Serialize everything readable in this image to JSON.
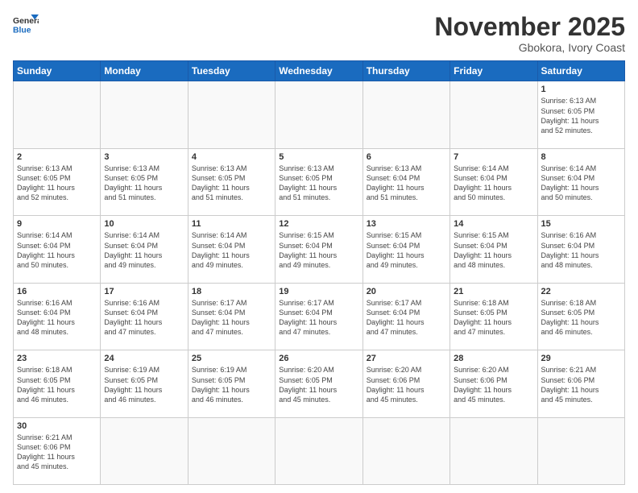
{
  "logo": {
    "text_general": "General",
    "text_blue": "Blue"
  },
  "title": "November 2025",
  "location": "Gbokora, Ivory Coast",
  "days": [
    "Sunday",
    "Monday",
    "Tuesday",
    "Wednesday",
    "Thursday",
    "Friday",
    "Saturday"
  ],
  "weeks": [
    [
      {
        "date": "",
        "text": ""
      },
      {
        "date": "",
        "text": ""
      },
      {
        "date": "",
        "text": ""
      },
      {
        "date": "",
        "text": ""
      },
      {
        "date": "",
        "text": ""
      },
      {
        "date": "",
        "text": ""
      },
      {
        "date": "1",
        "text": "Sunrise: 6:13 AM\nSunset: 6:05 PM\nDaylight: 11 hours\nand 52 minutes."
      }
    ],
    [
      {
        "date": "2",
        "text": "Sunrise: 6:13 AM\nSunset: 6:05 PM\nDaylight: 11 hours\nand 52 minutes."
      },
      {
        "date": "3",
        "text": "Sunrise: 6:13 AM\nSunset: 6:05 PM\nDaylight: 11 hours\nand 51 minutes."
      },
      {
        "date": "4",
        "text": "Sunrise: 6:13 AM\nSunset: 6:05 PM\nDaylight: 11 hours\nand 51 minutes."
      },
      {
        "date": "5",
        "text": "Sunrise: 6:13 AM\nSunset: 6:05 PM\nDaylight: 11 hours\nand 51 minutes."
      },
      {
        "date": "6",
        "text": "Sunrise: 6:13 AM\nSunset: 6:04 PM\nDaylight: 11 hours\nand 51 minutes."
      },
      {
        "date": "7",
        "text": "Sunrise: 6:14 AM\nSunset: 6:04 PM\nDaylight: 11 hours\nand 50 minutes."
      },
      {
        "date": "8",
        "text": "Sunrise: 6:14 AM\nSunset: 6:04 PM\nDaylight: 11 hours\nand 50 minutes."
      }
    ],
    [
      {
        "date": "9",
        "text": "Sunrise: 6:14 AM\nSunset: 6:04 PM\nDaylight: 11 hours\nand 50 minutes."
      },
      {
        "date": "10",
        "text": "Sunrise: 6:14 AM\nSunset: 6:04 PM\nDaylight: 11 hours\nand 49 minutes."
      },
      {
        "date": "11",
        "text": "Sunrise: 6:14 AM\nSunset: 6:04 PM\nDaylight: 11 hours\nand 49 minutes."
      },
      {
        "date": "12",
        "text": "Sunrise: 6:15 AM\nSunset: 6:04 PM\nDaylight: 11 hours\nand 49 minutes."
      },
      {
        "date": "13",
        "text": "Sunrise: 6:15 AM\nSunset: 6:04 PM\nDaylight: 11 hours\nand 49 minutes."
      },
      {
        "date": "14",
        "text": "Sunrise: 6:15 AM\nSunset: 6:04 PM\nDaylight: 11 hours\nand 48 minutes."
      },
      {
        "date": "15",
        "text": "Sunrise: 6:16 AM\nSunset: 6:04 PM\nDaylight: 11 hours\nand 48 minutes."
      }
    ],
    [
      {
        "date": "16",
        "text": "Sunrise: 6:16 AM\nSunset: 6:04 PM\nDaylight: 11 hours\nand 48 minutes."
      },
      {
        "date": "17",
        "text": "Sunrise: 6:16 AM\nSunset: 6:04 PM\nDaylight: 11 hours\nand 47 minutes."
      },
      {
        "date": "18",
        "text": "Sunrise: 6:17 AM\nSunset: 6:04 PM\nDaylight: 11 hours\nand 47 minutes."
      },
      {
        "date": "19",
        "text": "Sunrise: 6:17 AM\nSunset: 6:04 PM\nDaylight: 11 hours\nand 47 minutes."
      },
      {
        "date": "20",
        "text": "Sunrise: 6:17 AM\nSunset: 6:04 PM\nDaylight: 11 hours\nand 47 minutes."
      },
      {
        "date": "21",
        "text": "Sunrise: 6:18 AM\nSunset: 6:05 PM\nDaylight: 11 hours\nand 47 minutes."
      },
      {
        "date": "22",
        "text": "Sunrise: 6:18 AM\nSunset: 6:05 PM\nDaylight: 11 hours\nand 46 minutes."
      }
    ],
    [
      {
        "date": "23",
        "text": "Sunrise: 6:18 AM\nSunset: 6:05 PM\nDaylight: 11 hours\nand 46 minutes."
      },
      {
        "date": "24",
        "text": "Sunrise: 6:19 AM\nSunset: 6:05 PM\nDaylight: 11 hours\nand 46 minutes."
      },
      {
        "date": "25",
        "text": "Sunrise: 6:19 AM\nSunset: 6:05 PM\nDaylight: 11 hours\nand 46 minutes."
      },
      {
        "date": "26",
        "text": "Sunrise: 6:20 AM\nSunset: 6:05 PM\nDaylight: 11 hours\nand 45 minutes."
      },
      {
        "date": "27",
        "text": "Sunrise: 6:20 AM\nSunset: 6:06 PM\nDaylight: 11 hours\nand 45 minutes."
      },
      {
        "date": "28",
        "text": "Sunrise: 6:20 AM\nSunset: 6:06 PM\nDaylight: 11 hours\nand 45 minutes."
      },
      {
        "date": "29",
        "text": "Sunrise: 6:21 AM\nSunset: 6:06 PM\nDaylight: 11 hours\nand 45 minutes."
      }
    ],
    [
      {
        "date": "30",
        "text": "Sunrise: 6:21 AM\nSunset: 6:06 PM\nDaylight: 11 hours\nand 45 minutes."
      },
      {
        "date": "",
        "text": ""
      },
      {
        "date": "",
        "text": ""
      },
      {
        "date": "",
        "text": ""
      },
      {
        "date": "",
        "text": ""
      },
      {
        "date": "",
        "text": ""
      },
      {
        "date": "",
        "text": ""
      }
    ]
  ]
}
